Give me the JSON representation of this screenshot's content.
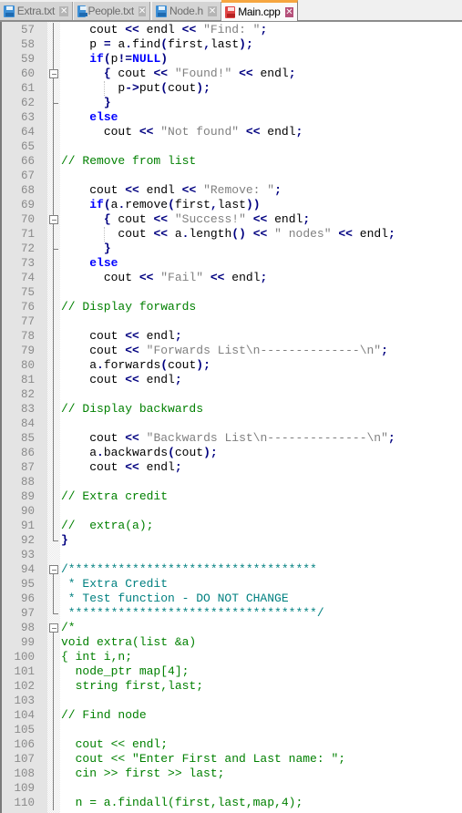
{
  "tabs": [
    {
      "label": "Extra.txt",
      "icon": "floppy-disk-icon",
      "active": false
    },
    {
      "label": "People.txt",
      "icon": "floppy-disk-icon",
      "active": false
    },
    {
      "label": "Node.h",
      "icon": "floppy-disk-icon",
      "active": false
    },
    {
      "label": "Main.cpp",
      "icon": "floppy-disk-unsaved-icon",
      "active": true
    }
  ],
  "tab_close_glyph": "✕",
  "colors": {
    "keyword": "#0000ff",
    "operator": "#000080",
    "string": "#808080",
    "comment": "#008000",
    "doc_comment": "#008080",
    "active_tab_accent": "#f6a640"
  },
  "editor": {
    "language": "C++",
    "first_line": 57,
    "lines": [
      {
        "n": "57",
        "tokens": [
          [
            "sp",
            "    "
          ],
          [
            "id",
            "cout "
          ],
          [
            "op",
            "<<"
          ],
          [
            "id",
            " endl "
          ],
          [
            "op",
            "<<"
          ],
          [
            "sp",
            " "
          ],
          [
            "str",
            "\"Find: \""
          ],
          [
            "op",
            ";"
          ]
        ]
      },
      {
        "n": "58",
        "tokens": [
          [
            "sp",
            "    "
          ],
          [
            "id",
            "p "
          ],
          [
            "op",
            "="
          ],
          [
            "id",
            " a"
          ],
          [
            "op",
            "."
          ],
          [
            "id",
            "find"
          ],
          [
            "op",
            "("
          ],
          [
            "id",
            "first"
          ],
          [
            "op",
            ","
          ],
          [
            "id",
            "last"
          ],
          [
            "op",
            ");"
          ]
        ]
      },
      {
        "n": "59",
        "tokens": [
          [
            "sp",
            "    "
          ],
          [
            "kw",
            "if"
          ],
          [
            "op",
            "("
          ],
          [
            "id",
            "p"
          ],
          [
            "op",
            "!="
          ],
          [
            "kw",
            "NULL"
          ],
          [
            "op",
            ")"
          ]
        ]
      },
      {
        "n": "60",
        "tokens": [
          [
            "sp",
            "      "
          ],
          [
            "op",
            "{"
          ],
          [
            "id",
            " cout "
          ],
          [
            "op",
            "<<"
          ],
          [
            "sp",
            " "
          ],
          [
            "str",
            "\"Found!\""
          ],
          [
            "sp",
            " "
          ],
          [
            "op",
            "<<"
          ],
          [
            "id",
            " endl"
          ],
          [
            "op",
            ";"
          ]
        ]
      },
      {
        "n": "61",
        "tokens": [
          [
            "sp",
            "        "
          ],
          [
            "id",
            "p"
          ],
          [
            "op",
            "->"
          ],
          [
            "id",
            "put"
          ],
          [
            "op",
            "("
          ],
          [
            "id",
            "cout"
          ],
          [
            "op",
            ");"
          ]
        ]
      },
      {
        "n": "62",
        "tokens": [
          [
            "sp",
            "      "
          ],
          [
            "op",
            "}"
          ]
        ]
      },
      {
        "n": "63",
        "tokens": [
          [
            "sp",
            "    "
          ],
          [
            "kw",
            "else"
          ]
        ]
      },
      {
        "n": "64",
        "tokens": [
          [
            "sp",
            "      "
          ],
          [
            "id",
            "cout "
          ],
          [
            "op",
            "<<"
          ],
          [
            "sp",
            " "
          ],
          [
            "str",
            "\"Not found\""
          ],
          [
            "sp",
            " "
          ],
          [
            "op",
            "<<"
          ],
          [
            "id",
            " endl"
          ],
          [
            "op",
            ";"
          ]
        ]
      },
      {
        "n": "65",
        "tokens": []
      },
      {
        "n": "66",
        "tokens": [
          [
            "cm",
            "// Remove from list"
          ]
        ]
      },
      {
        "n": "67",
        "tokens": []
      },
      {
        "n": "68",
        "tokens": [
          [
            "sp",
            "    "
          ],
          [
            "id",
            "cout "
          ],
          [
            "op",
            "<<"
          ],
          [
            "id",
            " endl "
          ],
          [
            "op",
            "<<"
          ],
          [
            "sp",
            " "
          ],
          [
            "str",
            "\"Remove: \""
          ],
          [
            "op",
            ";"
          ]
        ]
      },
      {
        "n": "69",
        "tokens": [
          [
            "sp",
            "    "
          ],
          [
            "kw",
            "if"
          ],
          [
            "op",
            "("
          ],
          [
            "id",
            "a"
          ],
          [
            "op",
            "."
          ],
          [
            "id",
            "remove"
          ],
          [
            "op",
            "("
          ],
          [
            "id",
            "first"
          ],
          [
            "op",
            ","
          ],
          [
            "id",
            "last"
          ],
          [
            "op",
            "))"
          ]
        ]
      },
      {
        "n": "70",
        "tokens": [
          [
            "sp",
            "      "
          ],
          [
            "op",
            "{"
          ],
          [
            "id",
            " cout "
          ],
          [
            "op",
            "<<"
          ],
          [
            "sp",
            " "
          ],
          [
            "str",
            "\"Success!\""
          ],
          [
            "sp",
            " "
          ],
          [
            "op",
            "<<"
          ],
          [
            "id",
            " endl"
          ],
          [
            "op",
            ";"
          ]
        ]
      },
      {
        "n": "71",
        "tokens": [
          [
            "sp",
            "        "
          ],
          [
            "id",
            "cout "
          ],
          [
            "op",
            "<<"
          ],
          [
            "id",
            " a"
          ],
          [
            "op",
            "."
          ],
          [
            "id",
            "length"
          ],
          [
            "op",
            "()"
          ],
          [
            "sp",
            " "
          ],
          [
            "op",
            "<<"
          ],
          [
            "sp",
            " "
          ],
          [
            "str",
            "\" nodes\""
          ],
          [
            "sp",
            " "
          ],
          [
            "op",
            "<<"
          ],
          [
            "id",
            " endl"
          ],
          [
            "op",
            ";"
          ]
        ]
      },
      {
        "n": "72",
        "tokens": [
          [
            "sp",
            "      "
          ],
          [
            "op",
            "}"
          ]
        ]
      },
      {
        "n": "73",
        "tokens": [
          [
            "sp",
            "    "
          ],
          [
            "kw",
            "else"
          ]
        ]
      },
      {
        "n": "74",
        "tokens": [
          [
            "sp",
            "      "
          ],
          [
            "id",
            "cout "
          ],
          [
            "op",
            "<<"
          ],
          [
            "sp",
            " "
          ],
          [
            "str",
            "\"Fail\""
          ],
          [
            "sp",
            " "
          ],
          [
            "op",
            "<<"
          ],
          [
            "id",
            " endl"
          ],
          [
            "op",
            ";"
          ]
        ]
      },
      {
        "n": "75",
        "tokens": []
      },
      {
        "n": "76",
        "tokens": [
          [
            "cm",
            "// Display forwards"
          ]
        ]
      },
      {
        "n": "77",
        "tokens": []
      },
      {
        "n": "78",
        "tokens": [
          [
            "sp",
            "    "
          ],
          [
            "id",
            "cout "
          ],
          [
            "op",
            "<<"
          ],
          [
            "id",
            " endl"
          ],
          [
            "op",
            ";"
          ]
        ]
      },
      {
        "n": "79",
        "tokens": [
          [
            "sp",
            "    "
          ],
          [
            "id",
            "cout "
          ],
          [
            "op",
            "<<"
          ],
          [
            "sp",
            " "
          ],
          [
            "str",
            "\"Forwards List\\n--------------\\n\""
          ],
          [
            "op",
            ";"
          ]
        ]
      },
      {
        "n": "80",
        "tokens": [
          [
            "sp",
            "    "
          ],
          [
            "id",
            "a"
          ],
          [
            "op",
            "."
          ],
          [
            "id",
            "forwards"
          ],
          [
            "op",
            "("
          ],
          [
            "id",
            "cout"
          ],
          [
            "op",
            ");"
          ]
        ]
      },
      {
        "n": "81",
        "tokens": [
          [
            "sp",
            "    "
          ],
          [
            "id",
            "cout "
          ],
          [
            "op",
            "<<"
          ],
          [
            "id",
            " endl"
          ],
          [
            "op",
            ";"
          ]
        ]
      },
      {
        "n": "82",
        "tokens": []
      },
      {
        "n": "83",
        "tokens": [
          [
            "cm",
            "// Display backwards"
          ]
        ]
      },
      {
        "n": "84",
        "tokens": []
      },
      {
        "n": "85",
        "tokens": [
          [
            "sp",
            "    "
          ],
          [
            "id",
            "cout "
          ],
          [
            "op",
            "<<"
          ],
          [
            "sp",
            " "
          ],
          [
            "str",
            "\"Backwards List\\n--------------\\n\""
          ],
          [
            "op",
            ";"
          ]
        ]
      },
      {
        "n": "86",
        "tokens": [
          [
            "sp",
            "    "
          ],
          [
            "id",
            "a"
          ],
          [
            "op",
            "."
          ],
          [
            "id",
            "backwards"
          ],
          [
            "op",
            "("
          ],
          [
            "id",
            "cout"
          ],
          [
            "op",
            ");"
          ]
        ]
      },
      {
        "n": "87",
        "tokens": [
          [
            "sp",
            "    "
          ],
          [
            "id",
            "cout "
          ],
          [
            "op",
            "<<"
          ],
          [
            "id",
            " endl"
          ],
          [
            "op",
            ";"
          ]
        ]
      },
      {
        "n": "88",
        "tokens": []
      },
      {
        "n": "89",
        "tokens": [
          [
            "cm",
            "// Extra credit"
          ]
        ]
      },
      {
        "n": "90",
        "tokens": []
      },
      {
        "n": "91",
        "tokens": [
          [
            "cm",
            "//  extra(a);"
          ]
        ]
      },
      {
        "n": "92",
        "tokens": [
          [
            "op",
            "}"
          ]
        ]
      },
      {
        "n": "93",
        "tokens": []
      },
      {
        "n": "94",
        "tokens": [
          [
            "cmdoc",
            "/***********************************"
          ]
        ]
      },
      {
        "n": "95",
        "tokens": [
          [
            "cmdoc",
            " * Extra Credit"
          ]
        ]
      },
      {
        "n": "96",
        "tokens": [
          [
            "cmdoc",
            " * Test function - DO NOT CHANGE"
          ]
        ]
      },
      {
        "n": "97",
        "tokens": [
          [
            "cmdoc",
            " ***********************************/"
          ]
        ]
      },
      {
        "n": "98",
        "tokens": [
          [
            "cm",
            "/*"
          ]
        ]
      },
      {
        "n": "99",
        "tokens": [
          [
            "cm",
            "void extra(list &a)"
          ]
        ]
      },
      {
        "n": "100",
        "tokens": [
          [
            "cm",
            "{ int i,n;"
          ]
        ]
      },
      {
        "n": "101",
        "tokens": [
          [
            "cm",
            "  node_ptr map[4];"
          ]
        ]
      },
      {
        "n": "102",
        "tokens": [
          [
            "cm",
            "  string first,last;"
          ]
        ]
      },
      {
        "n": "103",
        "tokens": []
      },
      {
        "n": "104",
        "tokens": [
          [
            "cm",
            "// Find node"
          ]
        ]
      },
      {
        "n": "105",
        "tokens": []
      },
      {
        "n": "106",
        "tokens": [
          [
            "cm",
            "  cout << endl;"
          ]
        ]
      },
      {
        "n": "107",
        "tokens": [
          [
            "cm",
            "  cout << \"Enter First and Last name: \";"
          ]
        ]
      },
      {
        "n": "108",
        "tokens": [
          [
            "cm",
            "  cin >> first >> last;"
          ]
        ]
      },
      {
        "n": "109",
        "tokens": []
      },
      {
        "n": "110",
        "tokens": [
          [
            "cm",
            "  n = a.findall(first,last,map,4);"
          ]
        ]
      }
    ],
    "folds": {
      "60": "open",
      "61": "line",
      "62": "end",
      "70": "open",
      "71": "line",
      "72": "end",
      "92": "end-outer",
      "94": "open",
      "95": "line",
      "96": "line",
      "97": "end",
      "98": "open",
      "99": "line",
      "100": "line",
      "101": "line",
      "102": "line",
      "103": "line",
      "104": "line",
      "105": "line",
      "106": "line",
      "107": "line",
      "108": "line",
      "109": "line",
      "110": "line"
    }
  }
}
